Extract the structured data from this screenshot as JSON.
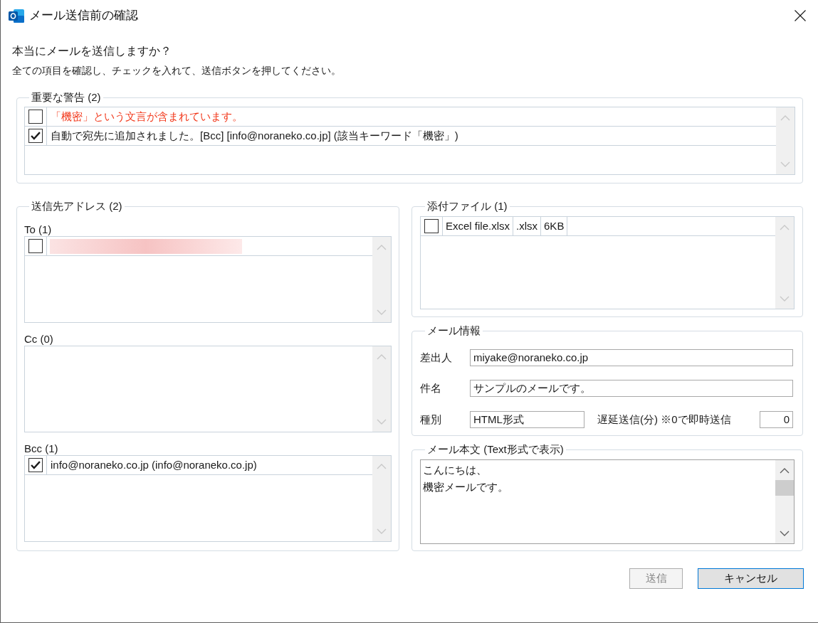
{
  "window": {
    "title": "メール送信前の確認"
  },
  "heading": "本当にメールを送信しますか？",
  "instruction": "全ての項目を確認し、チェックを入れて、送信ボタンを押してください。",
  "warnings": {
    "title": "重要な警告 (2)",
    "items": [
      {
        "kind": "alert",
        "checked": false,
        "text": "「機密」という文言が含まれています。"
      },
      {
        "kind": "info",
        "checked": true,
        "text": "自動で宛先に追加されました。[Bcc] [info@noraneko.co.jp] (該当キーワード「機密」)"
      }
    ]
  },
  "recipients": {
    "title": "送信先アドレス (2)",
    "lists": [
      {
        "label": "To (1)",
        "items": [
          {
            "checked": false,
            "blurred": true
          }
        ]
      },
      {
        "label": "Cc (0)"
      },
      {
        "label": "Bcc (1)",
        "items": [
          {
            "checked": true,
            "blurred": false,
            "text": "info@noraneko.co.jp (info@noraneko.co.jp)"
          }
        ]
      }
    ]
  },
  "attachments": {
    "title": "添付ファイル (1)",
    "items": [
      {
        "checked": false,
        "name": "Excel file.xlsx",
        "type": ".xlsx",
        "size": "6KB"
      }
    ]
  },
  "mail_info": {
    "title": "メール情報",
    "sender": {
      "label": "差出人",
      "value": "miyake@noraneko.co.jp"
    },
    "subject": {
      "label": "件名",
      "value": "サンプルのメールです。"
    },
    "format": {
      "label": "種別",
      "value": "HTML形式"
    },
    "delay": {
      "label": "遅延送信(分) ※0で即時送信",
      "value": "0"
    }
  },
  "body": {
    "title": "メール本文 (Text形式で表示)",
    "lines": [
      "こんにちは、",
      "機密メールです。"
    ]
  },
  "buttons": [
    {
      "label": "送信",
      "disabled": true,
      "focused": false
    },
    {
      "label": "キャンセル",
      "disabled": false,
      "focused": true
    }
  ]
}
